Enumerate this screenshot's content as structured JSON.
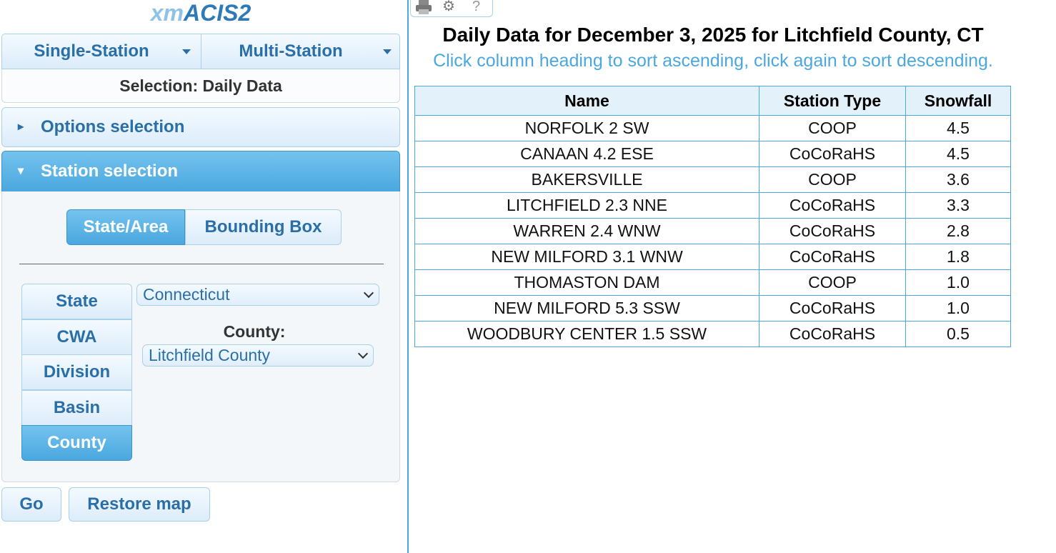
{
  "app": {
    "logo_prefix": "xm",
    "logo_main": "ACIS2"
  },
  "menu": {
    "single_label": "Single-Station",
    "multi_label": "Multi-Station"
  },
  "selection_text": "Selection: Daily Data",
  "accordion": {
    "options_label": "Options selection",
    "station_label": "Station selection"
  },
  "area_mode": {
    "state_area": "State/Area",
    "bounding_box": "Bounding Box",
    "active": "State/Area"
  },
  "area_tabs": [
    "State",
    "CWA",
    "Division",
    "Basin",
    "County"
  ],
  "active_area_tab": "County",
  "state_select": {
    "value": "Connecticut"
  },
  "county": {
    "label": "County:",
    "value": "Litchfield County"
  },
  "buttons": {
    "go": "Go",
    "restore_map": "Restore map"
  },
  "toolbar_icons": [
    "print-icon",
    "gear-icon",
    "help-icon"
  ],
  "report": {
    "title": "Daily Data for December 3, 2025 for Litchfield County, CT",
    "sort_hint": "Click column heading to sort ascending, click again to sort descending.",
    "columns": [
      "Name",
      "Station Type",
      "Snowfall"
    ],
    "rows": [
      [
        "NORFOLK 2 SW",
        "COOP",
        "4.5"
      ],
      [
        "CANAAN 4.2 ESE",
        "CoCoRaHS",
        "4.5"
      ],
      [
        "BAKERSVILLE",
        "COOP",
        "3.6"
      ],
      [
        "LITCHFIELD 2.3 NNE",
        "CoCoRaHS",
        "3.3"
      ],
      [
        "WARREN 2.4 WNW",
        "CoCoRaHS",
        "2.8"
      ],
      [
        "NEW MILFORD 3.1 WNW",
        "CoCoRaHS",
        "1.8"
      ],
      [
        "THOMASTON DAM",
        "COOP",
        "1.0"
      ],
      [
        "NEW MILFORD 5.3 SSW",
        "CoCoRaHS",
        "1.0"
      ],
      [
        "WOODBURY CENTER 1.5 SSW",
        "CoCoRaHS",
        "0.5"
      ]
    ]
  },
  "colors": {
    "accent": "#4aa7df",
    "link_text": "#2a6fa8",
    "header_bg": "#e3f1fa"
  }
}
